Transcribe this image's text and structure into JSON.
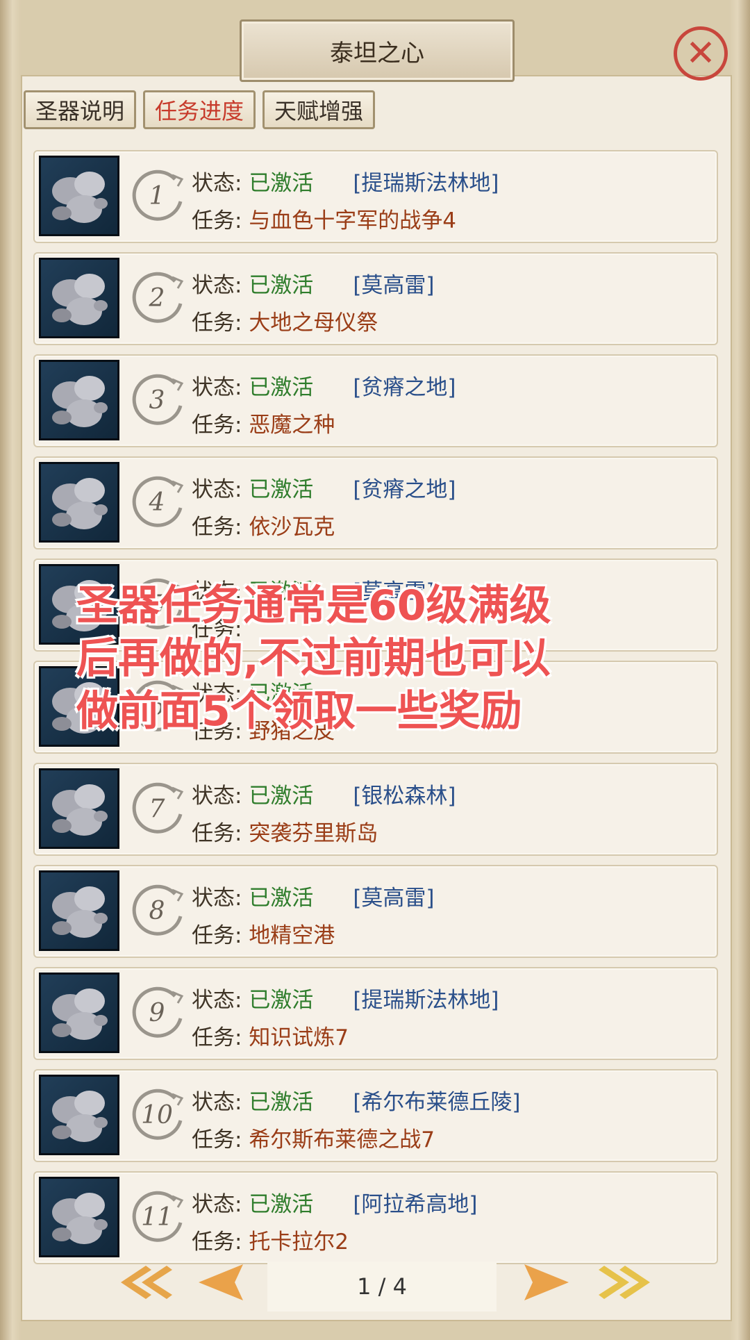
{
  "window": {
    "title": "泰坦之心"
  },
  "tabs": [
    {
      "label": "圣器说明",
      "active": false
    },
    {
      "label": "任务进度",
      "active": true
    },
    {
      "label": "天赋增强",
      "active": false
    }
  ],
  "labels": {
    "status_prefix": "状态:",
    "task_prefix": "任务:"
  },
  "rows": [
    {
      "num": "1",
      "status": "已激活",
      "location": "[提瑞斯法林地]",
      "task": "与血色十字军的战争4"
    },
    {
      "num": "2",
      "status": "已激活",
      "location": "[莫高雷]",
      "task": "大地之母仪祭"
    },
    {
      "num": "3",
      "status": "已激活",
      "location": "[贫瘠之地]",
      "task": "恶魔之种"
    },
    {
      "num": "4",
      "status": "已激活",
      "location": "[贫瘠之地]",
      "task": "依沙瓦克"
    },
    {
      "num": "5",
      "status": "已激活",
      "location": "[莫高雷]",
      "task": ""
    },
    {
      "num": "6",
      "status": "已激活",
      "location": "",
      "task": "野猪之皮"
    },
    {
      "num": "7",
      "status": "已激活",
      "location": "[银松森林]",
      "task": "突袭芬里斯岛"
    },
    {
      "num": "8",
      "status": "已激活",
      "location": "[莫高雷]",
      "task": "地精空港"
    },
    {
      "num": "9",
      "status": "已激活",
      "location": "[提瑞斯法林地]",
      "task": "知识试炼7"
    },
    {
      "num": "10",
      "status": "已激活",
      "location": "[希尔布莱德丘陵]",
      "task": "希尔斯布莱德之战7"
    },
    {
      "num": "11",
      "status": "已激活",
      "location": "[阿拉希高地]",
      "task": "托卡拉尔2"
    }
  ],
  "pager": {
    "page": "1 / 4"
  },
  "overlay": {
    "lines": [
      "圣器任务通常是60级满级",
      "后再做的,不过前期也可以",
      "做前面5个领取一些奖励"
    ]
  },
  "colors": {
    "status_green": "#2f7d2c",
    "location_blue": "#2a4f8a",
    "task_red": "#9a3d17",
    "active_tab": "#c73a2b",
    "overlay_red": "#ee5353"
  },
  "icons": {
    "close": "close-x-icon",
    "row_icon": "stone-artifact-icon",
    "badge": "dragon-ring-icon",
    "first": "double-left-arrow-icon",
    "prev": "left-arrow-icon",
    "next": "right-arrow-icon",
    "last": "double-right-arrow-icon"
  }
}
